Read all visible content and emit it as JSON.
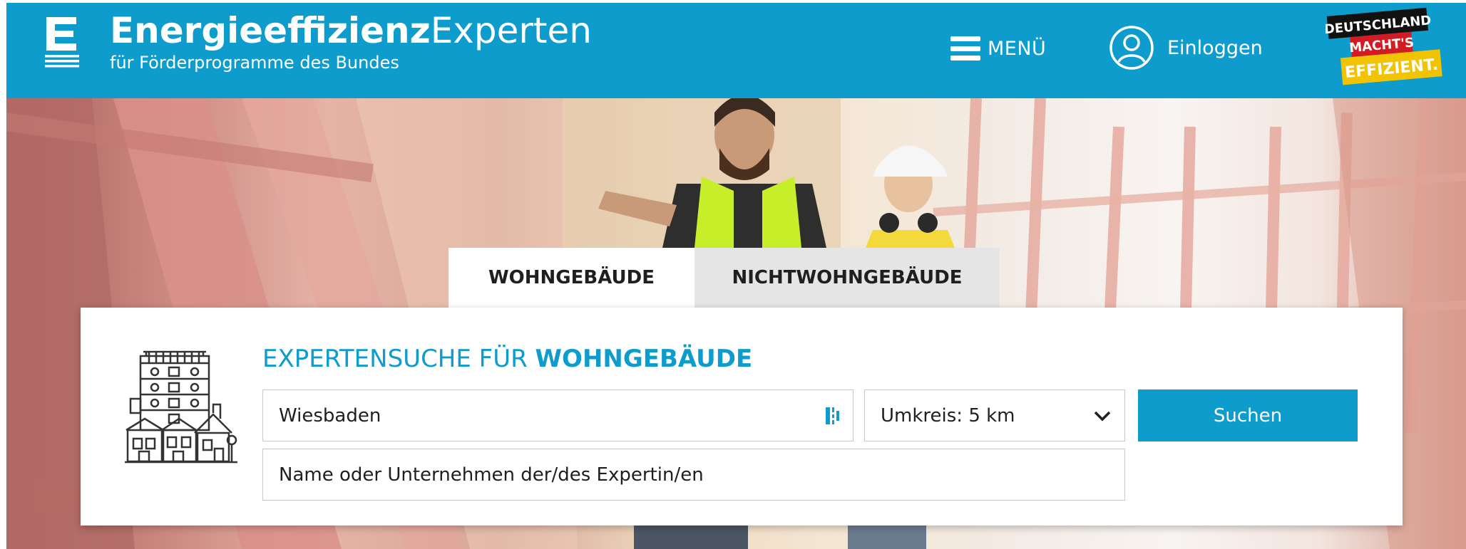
{
  "header": {
    "brand_bold": "Energieeffizienz",
    "brand_light": "Experten",
    "brand_sub": "für Förderprogramme des Bundes",
    "menu_label": "MENÜ",
    "login_label": "Einloggen",
    "badge": {
      "line1": "DEUTSCHLAND",
      "line2": "MACHT'S",
      "line3": "EFFIZIENT."
    }
  },
  "tabs": [
    {
      "label": "WOHNGEBÄUDE",
      "active": true
    },
    {
      "label": "NICHTWOHNGEBÄUDE",
      "active": false
    }
  ],
  "search": {
    "title_prefix": "EXPERTENSUCHE FÜR",
    "title_highlight": "WOHNGEBÄUDE",
    "location_value": "Wiesbaden",
    "radius_value": "Umkreis: 5 km",
    "name_placeholder": "Name oder Unternehmen der/des Expertin/en",
    "button_label": "Suchen"
  },
  "colors": {
    "brand_blue": "#0d9ccb",
    "tab_inactive": "#e5e5e5",
    "badge_red": "#d31b23",
    "badge_yellow": "#f2c300"
  },
  "icons": [
    "logo-e-icon",
    "menu-icon",
    "user-icon",
    "locate-icon",
    "chevron-down-icon",
    "residential-buildings-icon"
  ]
}
